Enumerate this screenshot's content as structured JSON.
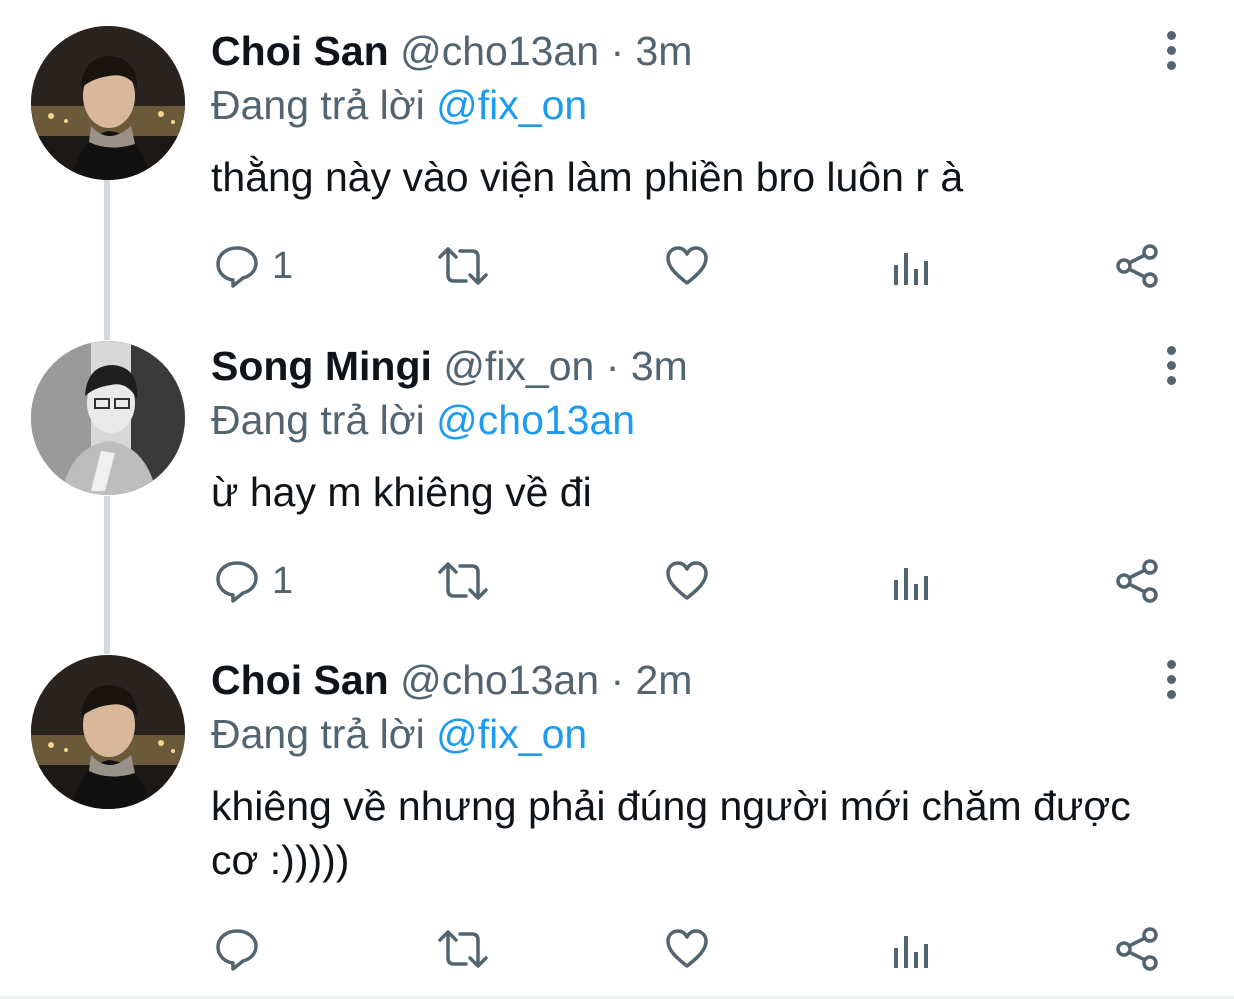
{
  "tweets": [
    {
      "name": "Choi San",
      "handle": "@cho13an",
      "separator": "·",
      "time": "3m",
      "reply_prefix": "Đang trả lời",
      "reply_to": "@fix_on",
      "text": "thằng này vào viện làm phiền bro luôn r à",
      "reply_count": "1",
      "avatar_icon": "profile-photo-color"
    },
    {
      "name": "Song Mingi",
      "handle": "@fix_on",
      "separator": "·",
      "time": "3m",
      "reply_prefix": "Đang trả lời",
      "reply_to": "@cho13an",
      "text": "ừ hay m khiêng về đi",
      "reply_count": "1",
      "avatar_icon": "profile-photo-monochrome"
    },
    {
      "name": "Choi San",
      "handle": "@cho13an",
      "separator": "·",
      "time": "2m",
      "reply_prefix": "Đang trả lời",
      "reply_to": "@fix_on",
      "text": "khiêng về nhưng phải đúng người mới chăm được cơ :)))))",
      "reply_count": "",
      "avatar_icon": "profile-photo-color"
    }
  ],
  "icons": {
    "more": "more-vertical-icon",
    "reply": "reply-icon",
    "retweet": "retweet-icon",
    "like": "like-icon",
    "analytics": "analytics-icon",
    "share": "share-icon"
  },
  "colors": {
    "text": "#0f1419",
    "secondary": "#536471",
    "mention": "#1d9bf0",
    "thread_line": "#cfd9de"
  }
}
